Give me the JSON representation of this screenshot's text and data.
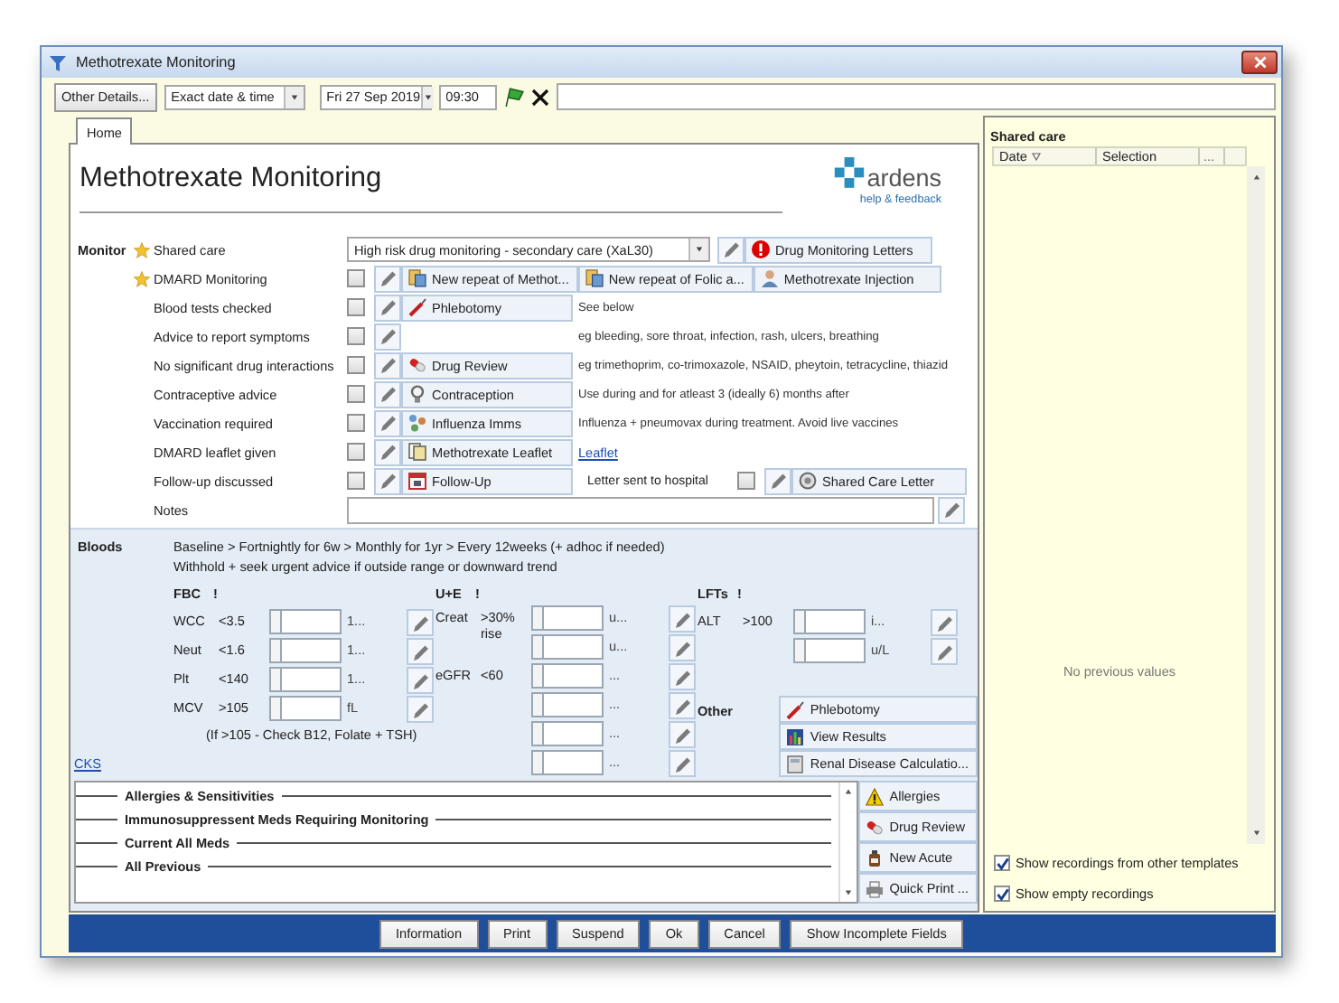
{
  "window": {
    "title": "Methotrexate Monitoring"
  },
  "toolbar": {
    "other_details": "Other Details...",
    "date_mode": "Exact date & time",
    "date": "Fri 27 Sep 2019",
    "time": "09:30"
  },
  "tabs": [
    {
      "label": "Home",
      "selected": true
    }
  ],
  "heading": "Methotrexate Monitoring",
  "logo": {
    "name": "ardens",
    "tagline": "help & feedback"
  },
  "monitor": {
    "label": "Monitor",
    "rows": [
      {
        "kind": "dropdown",
        "label": "Shared care",
        "starred": true,
        "value": "High risk drug monitoring - secondary care (XaL30)",
        "buttons": [
          {
            "kind": "alert",
            "label": "Drug Monitoring Letters"
          }
        ]
      },
      {
        "kind": "check",
        "label": "DMARD Monitoring",
        "starred": true,
        "checked": false,
        "buttons": [
          {
            "kind": "repeat",
            "label": "New repeat of Methot..."
          },
          {
            "kind": "repeat",
            "label": "New repeat of Folic a..."
          },
          {
            "kind": "injection",
            "label": "Methotrexate Injection"
          }
        ]
      },
      {
        "kind": "check",
        "label": "Blood tests checked",
        "starred": false,
        "checked": false,
        "buttons": [
          {
            "kind": "phlebotomy",
            "label": "Phlebotomy"
          }
        ],
        "note": "See below"
      },
      {
        "kind": "check",
        "label": "Advice to report symptoms",
        "starred": false,
        "checked": false,
        "note": "eg bleeding, sore throat, infection, rash, ulcers, breathing"
      },
      {
        "kind": "check",
        "label": "No significant drug interactions",
        "starred": false,
        "checked": false,
        "buttons": [
          {
            "kind": "review",
            "label": "Drug Review"
          }
        ],
        "note": "eg trimethoprim, co-trimoxazole, NSAID, pheytoin, tetracycline, thiazid"
      },
      {
        "kind": "check",
        "label": "Contraceptive advice",
        "starred": false,
        "checked": false,
        "buttons": [
          {
            "kind": "contraception",
            "label": "Contraception"
          }
        ],
        "note": "Use during and for atleast 3 (ideally 6) months after"
      },
      {
        "kind": "check",
        "label": "Vaccination required",
        "starred": false,
        "checked": false,
        "buttons": [
          {
            "kind": "imms",
            "label": "Influenza Imms"
          }
        ],
        "note": "Influenza + pneumovax during treatment. Avoid live vaccines"
      },
      {
        "kind": "check",
        "label": "DMARD leaflet given",
        "starred": false,
        "checked": false,
        "buttons": [
          {
            "kind": "leaflet",
            "label": "Methotrexate Leaflet"
          }
        ],
        "link": "Leaflet"
      },
      {
        "kind": "check",
        "label": "Follow-up discussed",
        "starred": false,
        "checked": false,
        "buttons": [
          {
            "kind": "followup",
            "label": "Follow-Up"
          }
        ],
        "extra": {
          "label": "Letter sent to hospital",
          "checked": false,
          "button": {
            "kind": "letter",
            "label": "Shared Care Letter"
          }
        }
      },
      {
        "kind": "notes",
        "label": "Notes"
      }
    ]
  },
  "bloods": {
    "label": "Bloods",
    "lines": [
      "Baseline > Fortnightly for 6w > Monthly for 1yr > Every 12weeks (+ adhoc if needed)",
      "Withhold + seek urgent advice if outside range or downward trend"
    ],
    "groups": [
      {
        "name": "FBC",
        "flag": "!",
        "tests": [
          {
            "name": "WCC",
            "limit": "<3.5",
            "unit": "1..."
          },
          {
            "name": "Neut",
            "limit": "<1.6",
            "unit": "1..."
          },
          {
            "name": "Plt",
            "limit": "<140",
            "unit": "1..."
          },
          {
            "name": "MCV",
            "limit": ">105",
            "unit": "fL"
          }
        ],
        "note": "(If >105 - Check B12, Folate + TSH)"
      },
      {
        "name": "U+E",
        "flag": "!",
        "tests": [
          {
            "name": "Creat",
            "limit": ">30% rise",
            "unit": "u..."
          },
          {
            "unit": "u..."
          },
          {
            "name": "eGFR",
            "limit": "<60",
            "unit": "..."
          },
          {
            "unit": "..."
          },
          {
            "unit": "..."
          },
          {
            "unit": "..."
          }
        ]
      },
      {
        "name": "LFTs",
        "flag": "!",
        "tests": [
          {
            "name": "ALT",
            "limit": ">100",
            "unit": "i..."
          },
          {
            "unit": "u/L"
          }
        ]
      }
    ],
    "other": {
      "label": "Other",
      "buttons": [
        {
          "kind": "phlebotomy",
          "label": "Phlebotomy"
        },
        {
          "kind": "results",
          "label": "View Results"
        },
        {
          "kind": "calculator",
          "label": "Renal Disease Calculatio..."
        }
      ]
    },
    "link": "CKS"
  },
  "meds": {
    "sections": [
      "Allergies & Sensitivities",
      "Immunosuppressent Meds Requiring Monitoring",
      "Current All Meds",
      "All Previous"
    ],
    "buttons": [
      {
        "kind": "allergy",
        "label": "Allergies"
      },
      {
        "kind": "review",
        "label": "Drug Review"
      },
      {
        "kind": "acute",
        "label": "New Acute"
      },
      {
        "kind": "print",
        "label": "Quick Print ..."
      }
    ]
  },
  "shared_panel": {
    "title": "Shared care",
    "columns": [
      "Date",
      "Selection",
      "..."
    ],
    "empty": "No previous values",
    "options": [
      {
        "label": "Show recordings from other templates",
        "checked": true
      },
      {
        "label": "Show empty recordings",
        "checked": true
      }
    ]
  },
  "footer": {
    "buttons": [
      "Information",
      "Print",
      "Suspend",
      "Ok",
      "Cancel",
      "Show Incomplete Fields"
    ]
  }
}
